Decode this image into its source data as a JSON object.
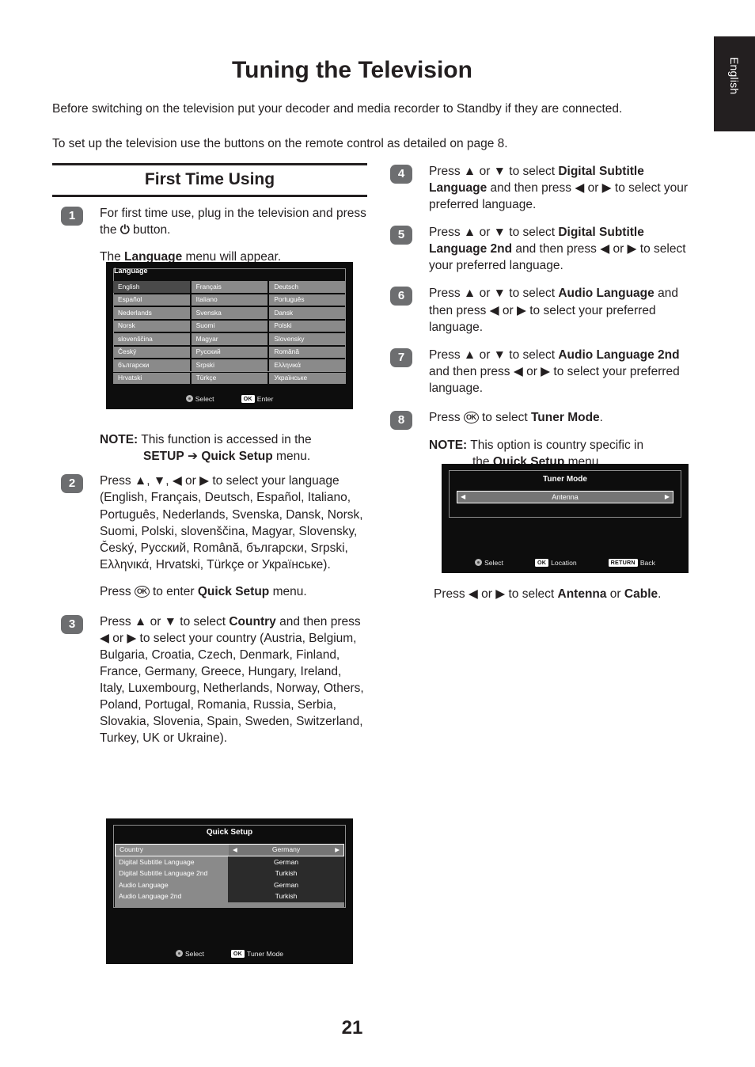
{
  "sidebar_tab": {
    "label": "English"
  },
  "page": {
    "title": "Tuning the Television",
    "number": "21",
    "intro_1": "Before switching on the television put your decoder and media recorder to Standby if they are connected.",
    "intro_2": "To set up the television use the buttons on the remote control as detailed on page 8."
  },
  "section": {
    "heading": "First Time Using"
  },
  "steps": {
    "s1": {
      "badge": "1",
      "line1_a": "For first time use, plug in the television and press the ",
      "line1_power": "⏻",
      "line1_b": " button.",
      "line2_a": "The ",
      "line2_b": "Language",
      "line2_c": " menu will appear."
    },
    "note1": {
      "label": "NOTE:",
      "text": " This function is accessed in the",
      "hang_a": "SETUP",
      "hang_arrow": "➔",
      "hang_b": "Quick Setup",
      "hang_c": " menu."
    },
    "s2": {
      "badge": "2",
      "text": "Press ▲, ▼, ◀ or ▶ to select your language (English, Français, Deutsch, Español, Italiano, Português, Nederlands, Svenska, Dansk, Norsk, Suomi, Polski, slovenščina, Magyar, Slovensky, Český, Русский, Română, български, Srpski, Ελληνικά, Hrvatski, Türkçe or Українське).",
      "line2_a": "Press ",
      "line2_ok": "OK",
      "line2_b": " to enter ",
      "line2_c": "Quick Setup",
      "line2_d": " menu."
    },
    "s3": {
      "badge": "3",
      "a": "Press ▲ or ▼ to select ",
      "b": "Country",
      "c": " and then press ◀ or ▶ to select your country (Austria, Belgium, Bulgaria, Croatia, Czech, Denmark, Finland, France, Germany, Greece, Hungary, Ireland, Italy, Luxembourg, Netherlands, Norway, Others, Poland, Portugal, Romania, Russia, Serbia, Slovakia, Slovenia, Spain, Sweden, Switzerland, Turkey, UK or Ukraine)."
    },
    "s4": {
      "badge": "4",
      "a": "Press ▲ or ▼ to select ",
      "b": "Digital Subtitle Language",
      "c": " and then press ◀ or ▶ to select your preferred language."
    },
    "s5": {
      "badge": "5",
      "a": "Press ▲ or ▼ to select ",
      "b": "Digital Subtitle Language 2nd",
      "c": " and then press ◀ or ▶ to select your preferred language."
    },
    "s6": {
      "badge": "6",
      "a": "Press ▲ or ▼ to select ",
      "b": "Audio Language",
      "c": " and then press ◀ or ▶ to select your preferred language."
    },
    "s7": {
      "badge": "7",
      "a": "Press ▲ or ▼ to select ",
      "b": "Audio Language 2nd",
      "c": " and then press ◀ or ▶ to select your preferred language."
    },
    "s8": {
      "badge": "8",
      "a": "Press ",
      "ok": "OK",
      "b": " to select ",
      "c": "Tuner Mode",
      "d": "."
    },
    "note2": {
      "label": "NOTE:",
      "text": " This option is country specific in",
      "hang_a": "the ",
      "hang_b": "Quick Setup",
      "hang_c": " menu."
    },
    "closing": {
      "a": "Press ◀ or ▶ to select ",
      "b": "Antenna",
      "c": " or ",
      "d": "Cable",
      "e": "."
    }
  },
  "osd_language": {
    "title": "Language",
    "selected": "English",
    "items": [
      "English",
      "Français",
      "Deutsch",
      "Español",
      "Italiano",
      "Português",
      "Nederlands",
      "Svenska",
      "Dansk",
      "Norsk",
      "Suomi",
      "Polski",
      "slovenščina",
      "Magyar",
      "Slovensky",
      "Český",
      "Русский",
      "Română",
      "български",
      "Srpski",
      "Ελληνικά",
      "Hrvatski",
      "Türkçe",
      "Українське"
    ],
    "footer": [
      {
        "icon": "dpad-icon",
        "key": "",
        "label": "Select"
      },
      {
        "icon": "keycap",
        "key": "OK",
        "label": "Enter"
      }
    ]
  },
  "osd_quick_setup": {
    "title": "Quick Setup",
    "rows": [
      {
        "label": "Country",
        "value": "Germany",
        "selected": true
      },
      {
        "label": "Digital Subtitle Language",
        "value": "German",
        "selected": false
      },
      {
        "label": "Digital Subtitle Language 2nd",
        "value": "Turkish",
        "selected": false
      },
      {
        "label": "Audio Language",
        "value": "German",
        "selected": false
      },
      {
        "label": "Audio Language 2nd",
        "value": "Turkish",
        "selected": false
      }
    ],
    "footer": [
      {
        "icon": "dpad-icon",
        "key": "",
        "label": "Select"
      },
      {
        "icon": "keycap",
        "key": "OK",
        "label": "Tuner Mode"
      }
    ]
  },
  "osd_tuner_mode": {
    "title": "Tuner Mode",
    "value": "Antenna",
    "footer": [
      {
        "icon": "dpad-icon",
        "key": "",
        "label": "Select"
      },
      {
        "icon": "keycap",
        "key": "OK",
        "label": "Location"
      },
      {
        "icon": "keycap",
        "key": "RETURN",
        "label": "Back"
      }
    ]
  },
  "glyphs": {
    "arrow_left": "◀",
    "arrow_right": "▶"
  }
}
